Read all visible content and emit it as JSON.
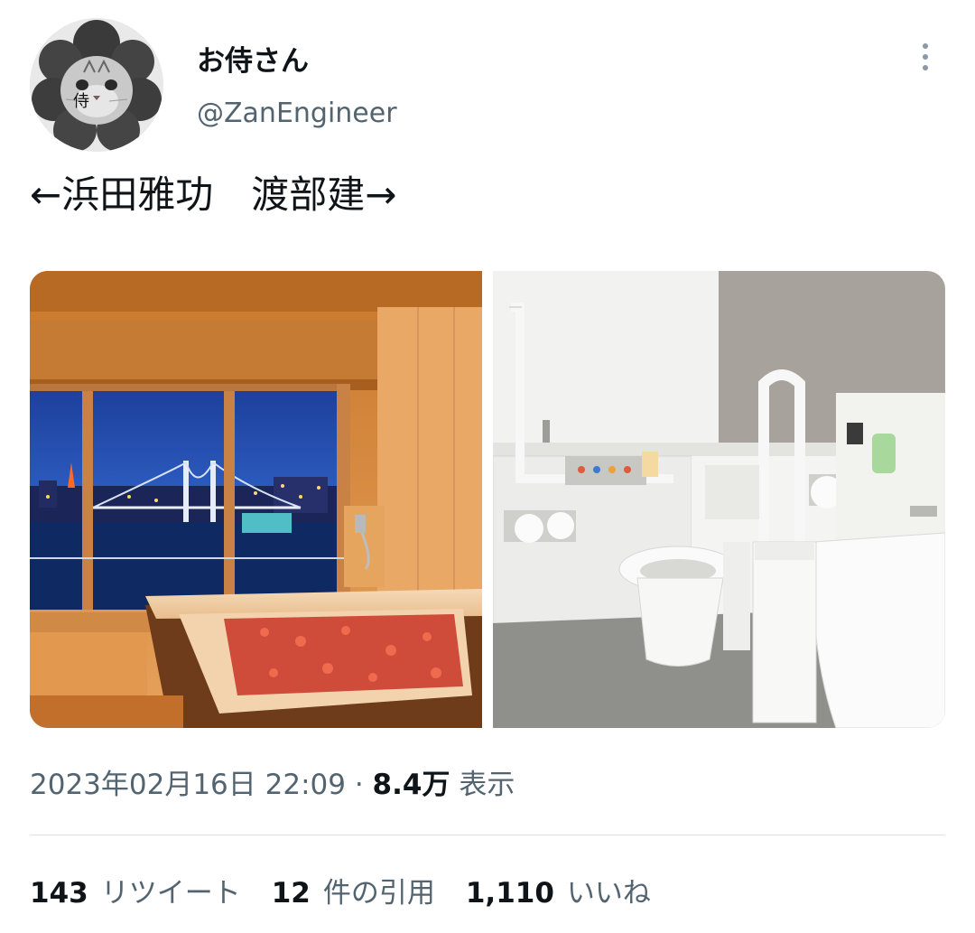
{
  "author": {
    "display_name": "お侍さん",
    "handle": "@ZanEngineer",
    "avatar_badge": "侍"
  },
  "tweet": {
    "text": "←浜田雅功　渡部建→"
  },
  "media": [
    {
      "kind": "photo",
      "subject": "hotel-bathroom-night-bay-view"
    },
    {
      "kind": "photo",
      "subject": "accessible-public-toilet"
    }
  ],
  "meta": {
    "timestamp": "2023年02月16日 22:09",
    "separator": " · ",
    "views_count": "8.4万",
    "views_label": " 表示"
  },
  "stats": {
    "retweets_count": "143",
    "retweets_label": "リツイート",
    "quotes_count": "12",
    "quotes_label": "件の引用",
    "likes_count": "1,110",
    "likes_label": "いいね"
  },
  "colors": {
    "text_primary": "#0f1419",
    "text_secondary": "#536471",
    "divider": "#dfe3e7"
  },
  "icons": {
    "more": "vertical-ellipsis-icon"
  }
}
